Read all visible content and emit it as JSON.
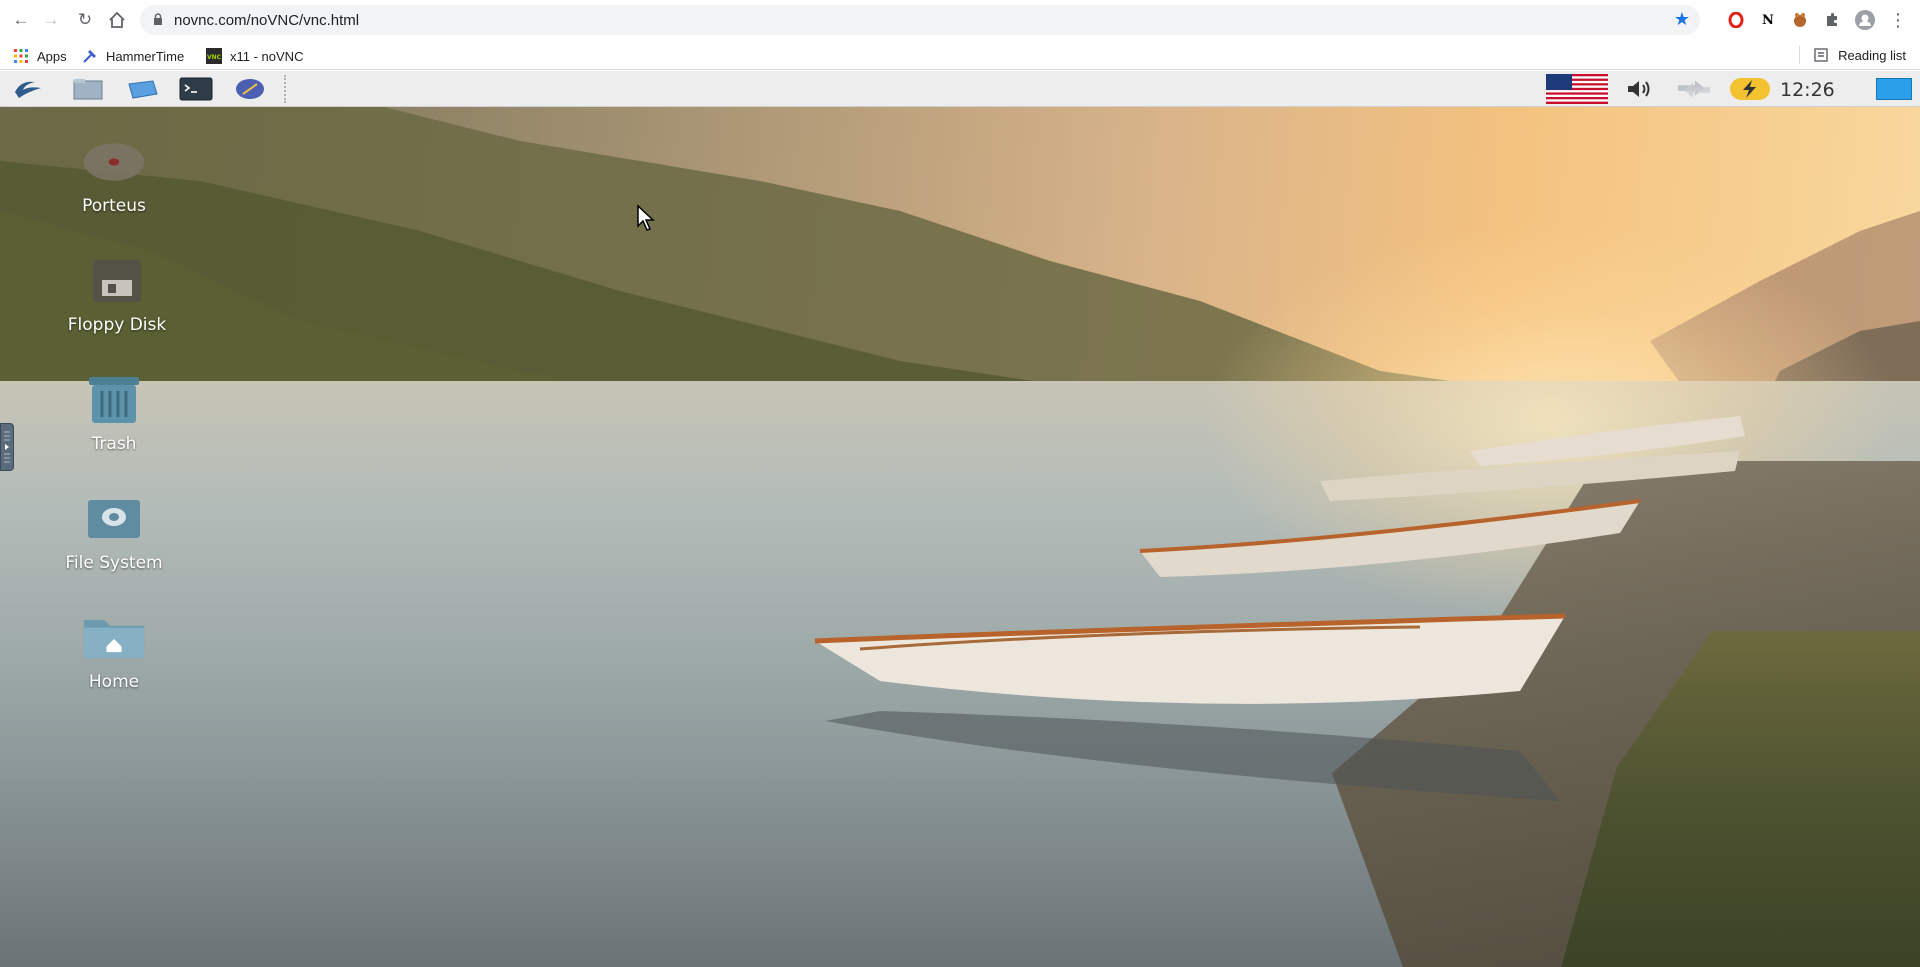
{
  "browser": {
    "url": "novnc.com/noVNC/vnc.html",
    "bookmarks": [
      {
        "label": "Apps",
        "icon": "apps-grid-icon"
      },
      {
        "label": "HammerTime",
        "icon": "hammer-icon"
      },
      {
        "label": "x11 - noVNC",
        "icon": "vnc-icon"
      }
    ],
    "reading_list": "Reading list"
  },
  "taskbar": {
    "launchers": [
      "porteus-menu-icon",
      "file-manager-icon",
      "desktop-icon",
      "terminal-icon",
      "browser-icon"
    ],
    "tray": [
      "us-flag-icon",
      "volume-icon",
      "network-icon",
      "power-icon"
    ],
    "clock": "12:26"
  },
  "desktop": {
    "icons": [
      {
        "label": "Porteus",
        "icon": "disc-icon"
      },
      {
        "label": "Floppy Disk",
        "icon": "floppy-icon"
      },
      {
        "label": "Trash",
        "icon": "trash-icon"
      },
      {
        "label": "File System",
        "icon": "drive-icon"
      },
      {
        "label": "Home",
        "icon": "home-folder-icon"
      }
    ]
  },
  "colors": {
    "accent": "#1a73e8",
    "taskbar": "#ededed",
    "power": "#f2c230"
  }
}
